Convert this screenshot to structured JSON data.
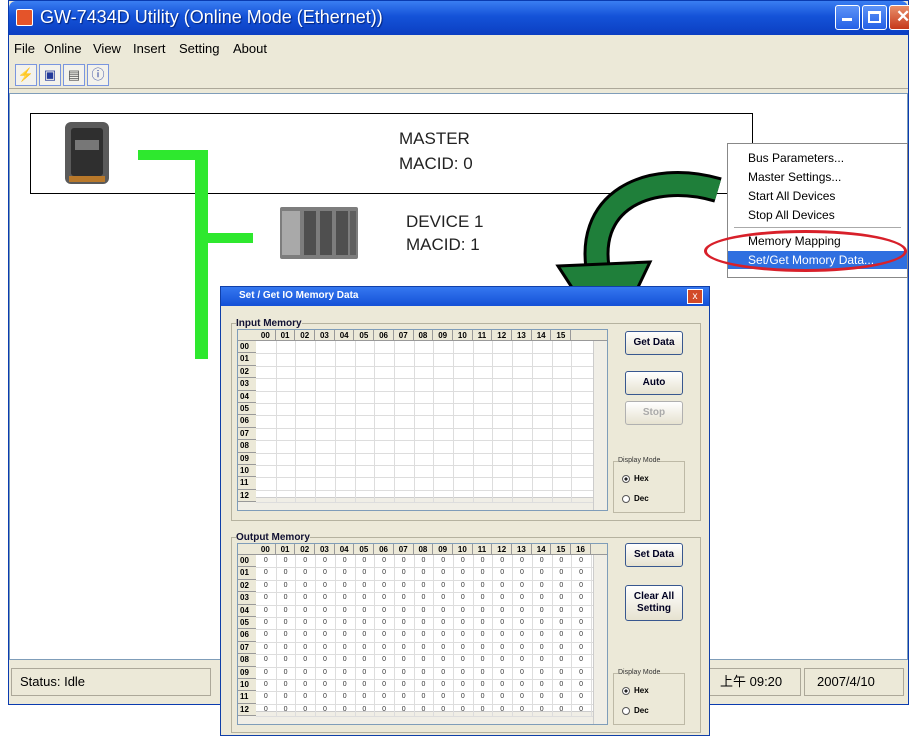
{
  "window": {
    "title": "GW-7434D Utility (Online Mode (Ethernet))"
  },
  "menu": [
    "File",
    "Online",
    "View",
    "Insert",
    "Setting",
    "About"
  ],
  "toolbar_icons": [
    "connect-icon",
    "save-icon",
    "open-icon",
    "info-icon"
  ],
  "network": {
    "master": {
      "name": "MASTER",
      "macid": "MACID:  0"
    },
    "device": {
      "name": "DEVICE 1",
      "macid": "MACID:   1"
    }
  },
  "context_menu": {
    "items": [
      "Bus Parameters...",
      "Master Settings...",
      "Start All Devices",
      "Stop All Devices",
      "Memory Mapping",
      "Set/Get Momory Data..."
    ],
    "highlighted_index": 5
  },
  "status": {
    "left": "Status: Idle",
    "time": "上午 09:20",
    "date": "2007/4/10"
  },
  "dialog": {
    "title": "Set / Get IO Memory Data",
    "close_glyph": "x",
    "input": {
      "group_title": "Input Memory",
      "columns": [
        "00",
        "01",
        "02",
        "03",
        "04",
        "05",
        "06",
        "07",
        "08",
        "09",
        "10",
        "11",
        "12",
        "13",
        "14",
        "15"
      ],
      "rows": [
        "00",
        "01",
        "02",
        "03",
        "04",
        "05",
        "06",
        "07",
        "08",
        "09",
        "10",
        "11",
        "12"
      ]
    },
    "output": {
      "group_title": "Output Memory",
      "columns": [
        "00",
        "01",
        "02",
        "03",
        "04",
        "05",
        "06",
        "07",
        "08",
        "09",
        "10",
        "11",
        "12",
        "13",
        "14",
        "15",
        "16"
      ],
      "rows": [
        "00",
        "01",
        "02",
        "03",
        "04",
        "05",
        "06",
        "07",
        "08",
        "09",
        "10",
        "11",
        "12"
      ],
      "cell_value": "0"
    },
    "buttons": {
      "get_data": "Get Data",
      "auto": "Auto",
      "stop": "Stop",
      "set_data": "Set Data",
      "clear_all_1": "Clear All",
      "clear_all_2": "Setting"
    },
    "display_mode": {
      "title": "Display Mode",
      "hex": "Hex",
      "dec": "Dec",
      "selected": "Hex"
    }
  },
  "colors": {
    "green_bus": "#2ee82e",
    "highlight": "#2f6fe0",
    "circle": "#d8202a",
    "arrow": "#1f7f3a"
  }
}
